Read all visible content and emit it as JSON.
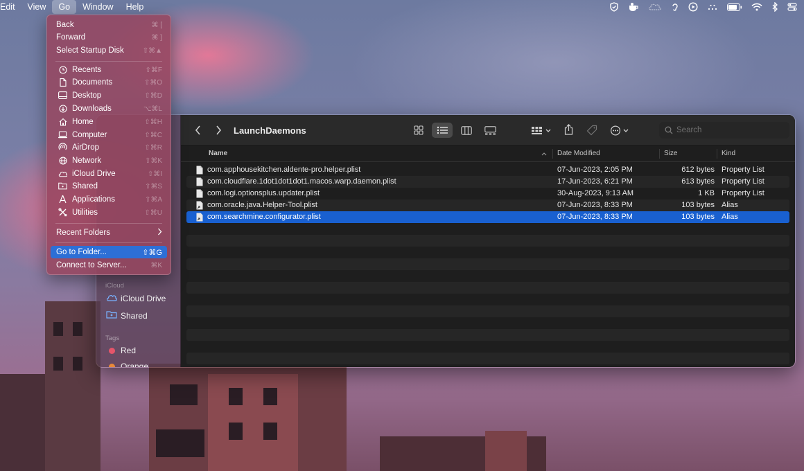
{
  "menubar": {
    "items": [
      "Edit",
      "View",
      "Go",
      "Window",
      "Help"
    ],
    "active": "Go"
  },
  "go_menu": {
    "group1": [
      {
        "label": "Back",
        "shortcut": "⌘ ["
      },
      {
        "label": "Forward",
        "shortcut": "⌘ ]"
      },
      {
        "label": "Select Startup Disk",
        "shortcut": "⇧⌘▲"
      }
    ],
    "group2": [
      {
        "label": "Recents",
        "shortcut": "⇧⌘F",
        "icon": "clock-icon"
      },
      {
        "label": "Documents",
        "shortcut": "⇧⌘O",
        "icon": "document-icon"
      },
      {
        "label": "Desktop",
        "shortcut": "⇧⌘D",
        "icon": "desktop-icon"
      },
      {
        "label": "Downloads",
        "shortcut": "⌥⌘L",
        "icon": "download-icon"
      },
      {
        "label": "Home",
        "shortcut": "⇧⌘H",
        "icon": "home-icon"
      },
      {
        "label": "Computer",
        "shortcut": "⇧⌘C",
        "icon": "computer-icon"
      },
      {
        "label": "AirDrop",
        "shortcut": "⇧⌘R",
        "icon": "airdrop-icon"
      },
      {
        "label": "Network",
        "shortcut": "⇧⌘K",
        "icon": "network-icon"
      },
      {
        "label": "iCloud Drive",
        "shortcut": "⇧⌘I",
        "icon": "cloud-icon"
      },
      {
        "label": "Shared",
        "shortcut": "⇧⌘S",
        "icon": "shared-folder-icon"
      },
      {
        "label": "Applications",
        "shortcut": "⇧⌘A",
        "icon": "applications-icon"
      },
      {
        "label": "Utilities",
        "shortcut": "⇧⌘U",
        "icon": "utilities-icon"
      }
    ],
    "recent_folders": "Recent Folders",
    "go_to_folder": {
      "label": "Go to Folder...",
      "shortcut": "⇧⌘G"
    },
    "connect_to_server": {
      "label": "Connect to Server...",
      "shortcut": "⌘K"
    }
  },
  "finder": {
    "title": "LaunchDaemons",
    "search_placeholder": "Search",
    "sidebar": {
      "icloud_heading": "iCloud",
      "icloud_drive": "iCloud Drive",
      "shared": "Shared",
      "tags_heading": "Tags",
      "tag_red": "Red",
      "tag_orange": "Orange"
    },
    "columns": {
      "name": "Name",
      "modified": "Date Modified",
      "size": "Size",
      "kind": "Kind"
    },
    "files": [
      {
        "name": "com.apphousekitchen.aldente-pro.helper.plist",
        "modified": "07-Jun-2023, 2:05 PM",
        "size": "612 bytes",
        "kind": "Property List"
      },
      {
        "name": "com.cloudflare.1dot1dot1dot1.macos.warp.daemon.plist",
        "modified": "17-Jun-2023, 6:21 PM",
        "size": "613 bytes",
        "kind": "Property List"
      },
      {
        "name": "com.logi.optionsplus.updater.plist",
        "modified": "30-Aug-2023, 9:13 AM",
        "size": "1 KB",
        "kind": "Property List"
      },
      {
        "name": "com.oracle.java.Helper-Tool.plist",
        "modified": "07-Jun-2023, 8:33 PM",
        "size": "103 bytes",
        "kind": "Alias"
      },
      {
        "name": "com.searchmine.configurator.plist",
        "modified": "07-Jun-2023, 8:33 PM",
        "size": "103 bytes",
        "kind": "Alias"
      }
    ],
    "selected_index": 4
  },
  "colors": {
    "selection": "#1960d0",
    "menu_highlight": "#2d6fd6",
    "tag_red": "#e5556a",
    "tag_orange": "#e8893a"
  }
}
